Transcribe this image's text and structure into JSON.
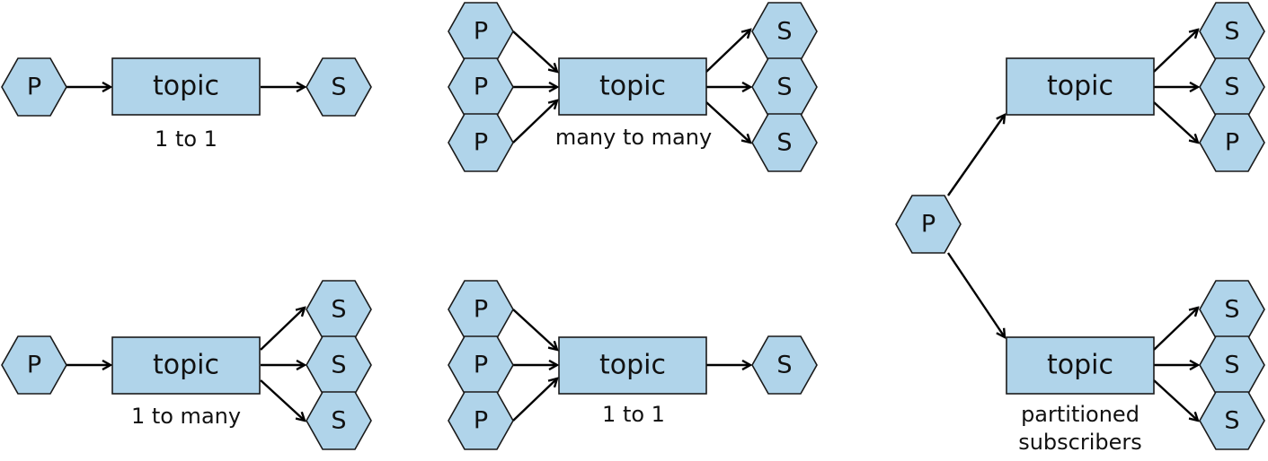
{
  "node_labels": {
    "publisher": "P",
    "subscriber": "S",
    "topic": "topic"
  },
  "captions": {
    "one_to_one_top": "1 to 1",
    "many_to_many": "many to many",
    "one_to_many": "1 to many",
    "many_to_one": "1 to 1",
    "partitioned_line1": "partitioned",
    "partitioned_line2": "subscribers"
  },
  "colors": {
    "node_fill": "#b0d4ea",
    "stroke": "#1a1a1a"
  }
}
